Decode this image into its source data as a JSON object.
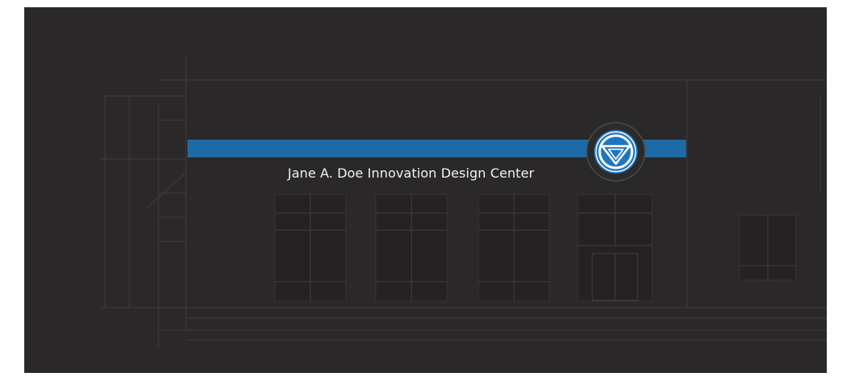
{
  "banner": {
    "title": "Jane A. Doe Innovation Design Center",
    "logo_icon": "gv-circle-logo",
    "colors": {
      "background": "#2a2828",
      "accent_bar": "#1d6aa6",
      "logo_blue": "#1f76c0",
      "logo_ring": "#2b2b2b"
    }
  }
}
